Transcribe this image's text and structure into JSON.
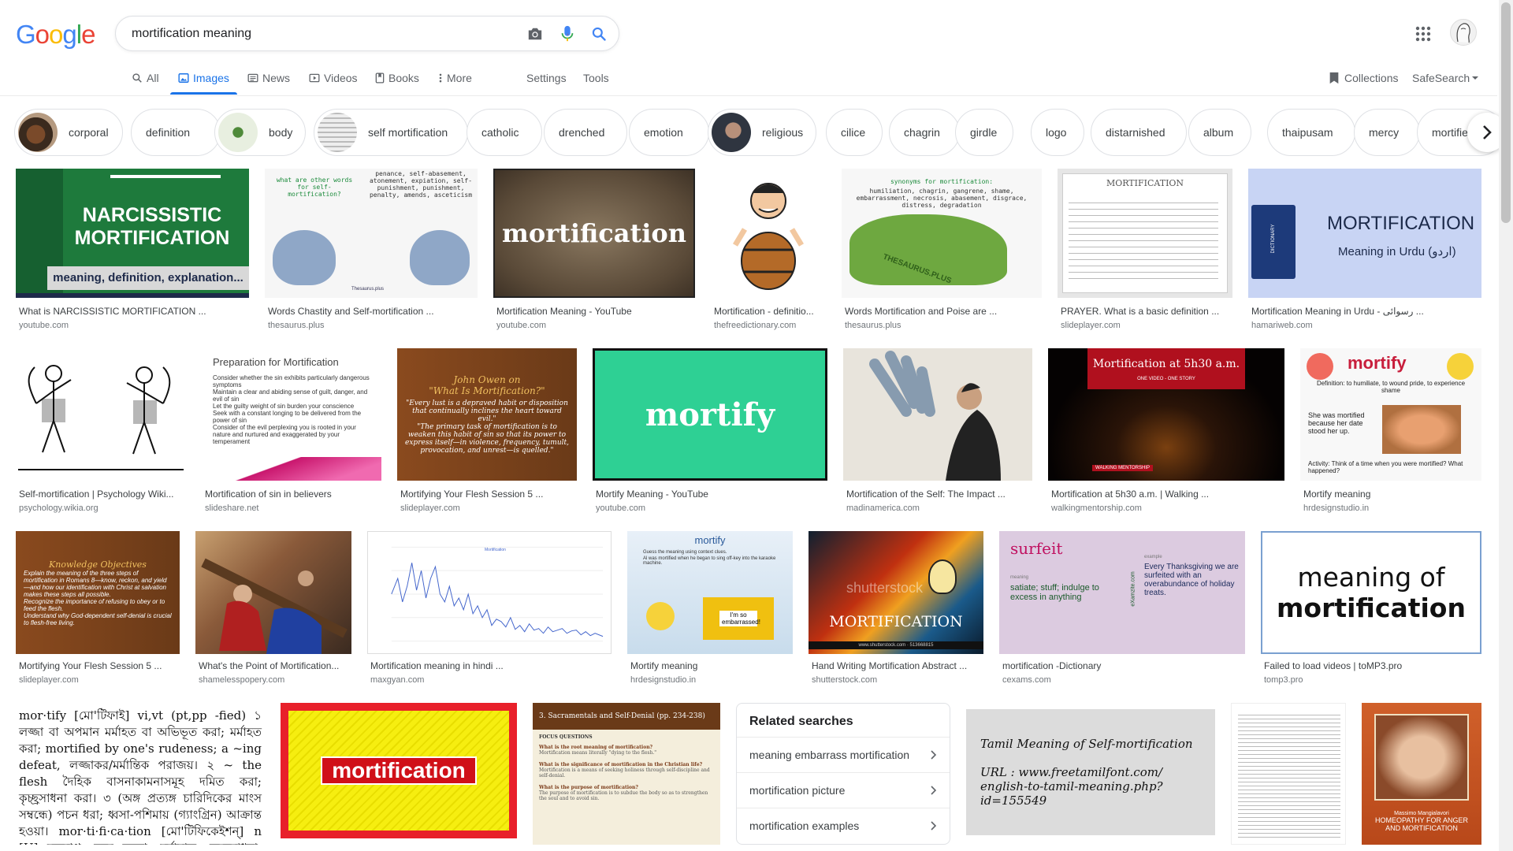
{
  "search": {
    "query": "mortification meaning"
  },
  "logo": {
    "letters": [
      "G",
      "o",
      "o",
      "g",
      "l",
      "e"
    ],
    "colors": [
      "#4285f4",
      "#ea4335",
      "#fbbc05",
      "#4285f4",
      "#34a853",
      "#ea4335"
    ]
  },
  "tabs": [
    {
      "label": "All",
      "icon": "search-icon"
    },
    {
      "label": "Images",
      "icon": "image-icon",
      "active": true
    },
    {
      "label": "News",
      "icon": "news-icon"
    },
    {
      "label": "Videos",
      "icon": "video-icon"
    },
    {
      "label": "Books",
      "icon": "book-icon"
    },
    {
      "label": "More",
      "icon": "more-vert-icon"
    }
  ],
  "tools": {
    "settings": "Settings",
    "tools": "Tools",
    "collections": "Collections",
    "safesearch": "SafeSearch"
  },
  "chips": [
    "corporal",
    "definition",
    "body",
    "self mortification",
    "catholic",
    "drenched",
    "emotion",
    "religious",
    "cilice",
    "chagrin",
    "girdle",
    "logo",
    "distarnished",
    "album",
    "thaipusam",
    "mercy",
    "mortifie"
  ],
  "images": [
    {
      "title": "What is NARCISSISTIC MORTIFICATION ...",
      "source": "youtube.com",
      "overlay": [
        "NARCISSISTIC",
        "MORTIFICATION",
        "meaning, definition, explanation..."
      ]
    },
    {
      "title": "Words Chastity and Self-mortification ...",
      "source": "thesaurus.plus",
      "overlay": [
        "what are other words for self-mortification?",
        "penance, self-abasement, atonement, expiation, self-punishment, punishment, penalty, amends, asceticism",
        "Thesaurus.plus"
      ]
    },
    {
      "title": "Mortification Meaning - YouTube",
      "source": "youtube.com",
      "overlay": [
        "mortification"
      ]
    },
    {
      "title": "Mortification - definitio...",
      "source": "thefreedictionary.com",
      "overlay": []
    },
    {
      "title": "Words Mortification and Poise are ...",
      "source": "thesaurus.plus",
      "overlay": [
        "synonyms for mortification:",
        "humiliation, chagrin, gangrene, shame, embarrassment, necrosis, abasement, disgrace, distress, degradation",
        "THESAURUS.PLUS"
      ]
    },
    {
      "title": "PRAYER. What is a basic definition ...",
      "source": "slideplayer.com",
      "overlay": [
        "MORTIFICATION"
      ]
    },
    {
      "title": "Mortification Meaning in Urdu - رسوائی ...",
      "source": "hamariweb.com",
      "overlay": [
        "MORTIFICATION",
        "Meaning in Urdu (اردو)",
        "DICTIONARY"
      ]
    },
    {
      "title": "Self-mortification | Psychology Wiki...",
      "source": "psychology.wikia.org",
      "overlay": []
    },
    {
      "title": "Mortification of sin in believers",
      "source": "slideshare.net",
      "overlay": [
        "Preparation for Mortification",
        "Consider whether the sin exhibits particularly dangerous symptoms",
        "Maintain a clear and abiding sense of guilt, danger, and evil of sin",
        "Let the guilty weight of sin burden your conscience",
        "Seek with a constant longing to be delivered from the power of sin",
        "Consider of the evil perplexing you is rooted in your nature and nurtured and exaggerated by your temperament"
      ]
    },
    {
      "title": "Mortifying Your Flesh Session 5 ...",
      "source": "slideplayer.com",
      "overlay": [
        "John Owen on",
        "\"What Is Mortification?\"",
        "\"Every lust is a depraved habit or disposition that continually inclines the heart toward evil.\"",
        "\"The primary task of mortification is to weaken this habit of sin so that its power to express itself—in violence, frequency, tumult, provocation, and unrest—is quelled.\""
      ]
    },
    {
      "title": "Mortify Meaning - YouTube",
      "source": "youtube.com",
      "overlay": [
        "mortify"
      ]
    },
    {
      "title": "Mortification of the Self: The Impact ...",
      "source": "madinamerica.com",
      "overlay": []
    },
    {
      "title": "Mortification at 5h30 a.m. | Walking ...",
      "source": "walkingmentorship.com",
      "overlay": [
        "Mortification at 5h30 a.m.",
        "ONE VIDEO - ONE STORY",
        "WALKING MENTORSHIP"
      ]
    },
    {
      "title": "Mortify meaning",
      "source": "hrdesignstudio.in",
      "overlay": [
        "mortify",
        "Definition: to humiliate, to wound pride, to experience shame",
        "She was mortified because her date stood her up.",
        "Activity: Think of a time when you were mortified? What happened?"
      ]
    },
    {
      "title": "Mortifying Your Flesh Session 5 ...",
      "source": "slideplayer.com",
      "overlay": [
        "Knowledge Objectives",
        "Explain the meaning of the three steps of mortification in Romans 8—know, reckon, and yield—and how our identification with Christ at salvation makes these steps all possible.",
        "Recognize the importance of refusing to obey or to feed the flesh.",
        "Understand why God-dependent self-denial is crucial to flesh-free living."
      ]
    },
    {
      "title": "What's the Point of Mortification...",
      "source": "shamelesspopery.com",
      "overlay": []
    },
    {
      "title": "Mortification meaning in hindi ...",
      "source": "maxgyan.com",
      "overlay": [
        "Mortification"
      ]
    },
    {
      "title": "Mortify meaning",
      "source": "hrdesignstudio.in",
      "overlay": [
        "mortify",
        "Guess the meaning using context clues.",
        "Al was mortified when he began to sing off-key into the karaoke machine.",
        "I'm so embarrassed!"
      ]
    },
    {
      "title": "Hand Writing Mortification Abstract ...",
      "source": "shutterstock.com",
      "overlay": [
        "MORTIFICATION",
        "shutterstock",
        "www.shutterstock.com · 513668815"
      ]
    },
    {
      "title": "mortification -Dictionary",
      "source": "cexams.com",
      "overlay": [
        "surfeit",
        "meaning",
        "satiate; stuff; indulge to excess in anything",
        "example",
        "Every Thanksgiving we are surfeited with an overabundance of holiday treats.",
        "eXamzite.com"
      ]
    },
    {
      "title": "Failed to load videos | toMP3.pro",
      "source": "tomp3.pro",
      "overlay": [
        "meaning of",
        "mortification"
      ]
    }
  ],
  "bottom_images": [
    {
      "overlay": [
        "mor·tify [মো'টিফাই] vi,vt (pt,pp -fied) ১ লজ্জা বা অপমান মর্মাহত বা অভিভূত করা; মর্মাহত করা; mortified by one's rudeness; a ~ing defeat, লজ্জাকর/মর্মান্তিক পরাজয়। ২ ~ the flesh দৈহিক বাসনাকামনাসমূহ দমিত করা; কৃচ্ছ্রসাধনা করা। ৩ (অঙ্গ প্রত্যঙ্গ চারিদিকের মাংস সম্বন্ধে) পচন ধরা; ধ্বসা-পশিমায় (গ্যাংগ্রিন) আক্রান্ত হওয়া। mor·ti·fi·ca·tion [মো'টিফিকেইশন্] n [U] মনস্তাপ; চরম লজ্জা; মর্মাঘাত; কৃচ্ছ্রসাধনা; পচন; পচনশীলতা।"
      ]
    },
    {
      "overlay": [
        "mortification"
      ]
    },
    {
      "overlay": [
        "3. Sacramentals and Self-Denial (pp. 234-238)",
        "FOCUS QUESTIONS",
        "What is the root meaning of mortification?",
        "Mortification means literally \"dying to the flesh.\"",
        "What is the significance of mortification in the Christian life?",
        "Mortification is a means of seeking holiness through self-discipline and self-denial.",
        "What is the purpose of mortification?",
        "The purpose of mortification is to subdue the body so as to strengthen the soul and to avoid sin."
      ]
    },
    {
      "overlay": [
        "Tamil Meaning of Self-mortification",
        "URL : www.freetamilfont.com/",
        "english-to-tamil-meaning.php?id=155549"
      ]
    },
    {
      "overlay": []
    },
    {
      "overlay": [
        "Massimo Mangialavori",
        "HOMEOPATHY FOR ANGER AND MORTIFICATION"
      ]
    }
  ],
  "related": {
    "heading": "Related searches",
    "items": [
      "meaning embarrass mortification",
      "mortification picture",
      "mortification examples"
    ]
  },
  "colors": {
    "accent": "#1a73e8",
    "search_icon": "#4285f4",
    "mic_blue": "#4285f4"
  }
}
